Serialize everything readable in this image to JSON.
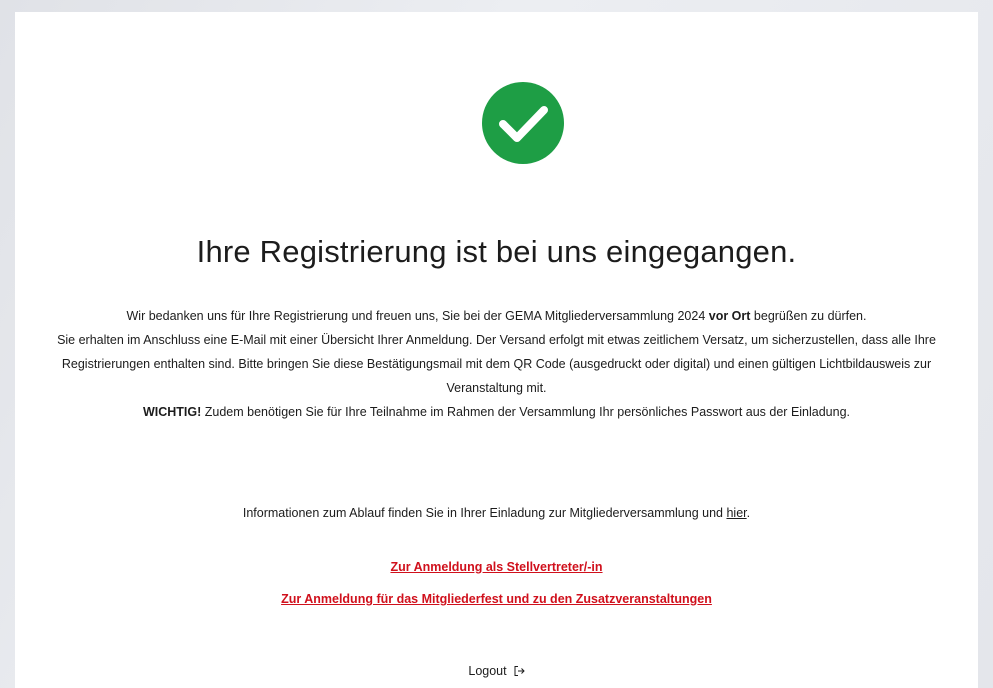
{
  "confirmation": {
    "icon": "check-circle-icon",
    "icon_color": "#1e9e45",
    "title": "Ihre Registrierung ist bei uns eingegangen.",
    "para1_pre": "Wir bedanken uns für Ihre Registrierung und freuen uns, Sie bei der GEMA Mitgliederversammlung 2024 ",
    "para1_bold": "vor Ort",
    "para1_post": " begrüßen zu dürfen.",
    "para2": "Sie erhalten im Anschluss eine E-Mail mit einer Übersicht Ihrer Anmeldung. Der Versand erfolgt mit etwas zeitlichem Versatz, um sicherzustellen, dass alle Ihre Registrierungen enthalten sind. Bitte bringen Sie diese Bestätigungsmail mit dem QR Code (ausgedruckt oder digital) und einen gültigen Lichtbildausweis zur Veranstaltung mit.",
    "para3_bold": "WICHTIG!",
    "para3_rest": " Zudem benötigen Sie für Ihre Teilnahme im Rahmen der Versammlung Ihr persönliches Passwort aus der Einladung.",
    "info_text": "Informationen zum Ablauf finden Sie in Ihrer Einladung zur Mitgliederversammlung und ",
    "info_link": "hier",
    "info_end": ".",
    "link_deputy": "Zur Anmeldung als Stellvertreter/-in",
    "link_fest": "Zur Anmeldung für das Mitgliederfest und zu den Zusatzveranstaltungen",
    "link_color": "#d0101c",
    "logout_label": "Logout",
    "logout_icon": "logout-icon"
  }
}
